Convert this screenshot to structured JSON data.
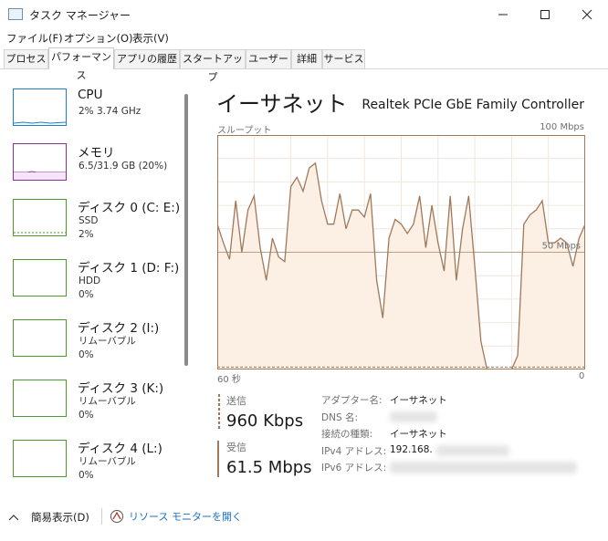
{
  "window": {
    "title": "タスク マネージャー"
  },
  "menu": [
    "ファイル(F)",
    "オプション(O)",
    "表示(V)"
  ],
  "tabs": [
    "プロセス",
    "パフォーマンス",
    "アプリの履歴",
    "スタートアップ",
    "ユーザー",
    "詳細",
    "サービス"
  ],
  "active_tab": "パフォーマンス",
  "sidebar": {
    "items": [
      {
        "title": "CPU",
        "lines": [
          "2%  3.74 GHz"
        ],
        "color": "#1780c8"
      },
      {
        "title": "メモリ",
        "lines": [
          "6.5/31.9 GB (20%)"
        ],
        "color": "#8b2e9b"
      },
      {
        "title": "ディスク 0 (C: E:)",
        "lines": [
          "SSD",
          "2%"
        ],
        "color": "#4b9b2a"
      },
      {
        "title": "ディスク 1 (D: F:)",
        "lines": [
          "HDD",
          "0%"
        ],
        "color": "#4b9b2a"
      },
      {
        "title": "ディスク 2 (I:)",
        "lines": [
          "リムーバブル",
          "0%"
        ],
        "color": "#4b9b2a"
      },
      {
        "title": "ディスク 3 (K:)",
        "lines": [
          "リムーバブル",
          "0%"
        ],
        "color": "#4b9b2a"
      },
      {
        "title": "ディスク 4 (L:)",
        "lines": [
          "リムーバブル",
          "0%"
        ],
        "color": "#4b9b2a"
      }
    ]
  },
  "main": {
    "title": "イーサネット",
    "adapter": "Realtek PCIe GbE Family Controller",
    "graph_label": "スループット",
    "graph_max": "100 Mbps",
    "graph_mid": "50 Mbps",
    "time_left": "60 秒",
    "time_right": "0",
    "send_label": "送信",
    "send_value": "960 Kbps",
    "recv_label": "受信",
    "recv_value": "61.5 Mbps",
    "info": [
      {
        "label": "アダプター名:",
        "value": "イーサネット"
      },
      {
        "label": "DNS 名:",
        "value": ""
      },
      {
        "label": "接続の種類:",
        "value": "イーサネット"
      },
      {
        "label": "IPv4 アドレス:",
        "value": "192.168."
      },
      {
        "label": "IPv6 アドレス:",
        "value": ""
      }
    ],
    "colors": {
      "line": "#a0785a",
      "fill": "#fcefe4",
      "grid": "#f1e6dc",
      "border": "#a0785a",
      "mid_line": "#b9a089"
    }
  },
  "chart_data": {
    "type": "line",
    "title": "",
    "xlabel": "",
    "ylabel": "",
    "xlim": [
      60,
      0
    ],
    "ylim": [
      0,
      100
    ],
    "series": [
      {
        "name": "受信",
        "x": [
          60,
          59,
          58,
          57,
          56,
          55,
          54,
          53,
          52,
          51,
          50,
          49,
          48,
          47,
          46,
          45,
          44,
          43,
          42,
          41,
          40,
          39,
          38,
          37,
          36,
          35,
          34,
          33,
          32,
          31,
          30,
          29,
          28,
          27,
          26,
          25,
          24,
          23,
          22,
          21,
          20,
          19,
          18,
          17,
          16,
          15,
          14,
          13,
          12,
          11,
          10,
          9,
          8,
          7,
          6,
          5,
          4,
          3,
          2,
          1,
          0
        ],
        "y": [
          62,
          54,
          47,
          72,
          50,
          68,
          74,
          52,
          38,
          56,
          48,
          46,
          78,
          82,
          76,
          86,
          88,
          72,
          62,
          62,
          75,
          60,
          68,
          68,
          65,
          75,
          38,
          22,
          56,
          64,
          62,
          58,
          62,
          74,
          52,
          70,
          54,
          42,
          74,
          38,
          60,
          74,
          44,
          12,
          0,
          0,
          0,
          0,
          0,
          6,
          62,
          66,
          68,
          72,
          54,
          54,
          56,
          54,
          44,
          56,
          62
        ]
      },
      {
        "name": "送信",
        "x": [
          60,
          45,
          30,
          15,
          0
        ],
        "y": [
          1,
          1,
          1,
          1,
          1
        ]
      }
    ]
  },
  "footer": {
    "brief_label": "簡易表示(D)",
    "monitor_label": "リソース モニターを開く"
  }
}
